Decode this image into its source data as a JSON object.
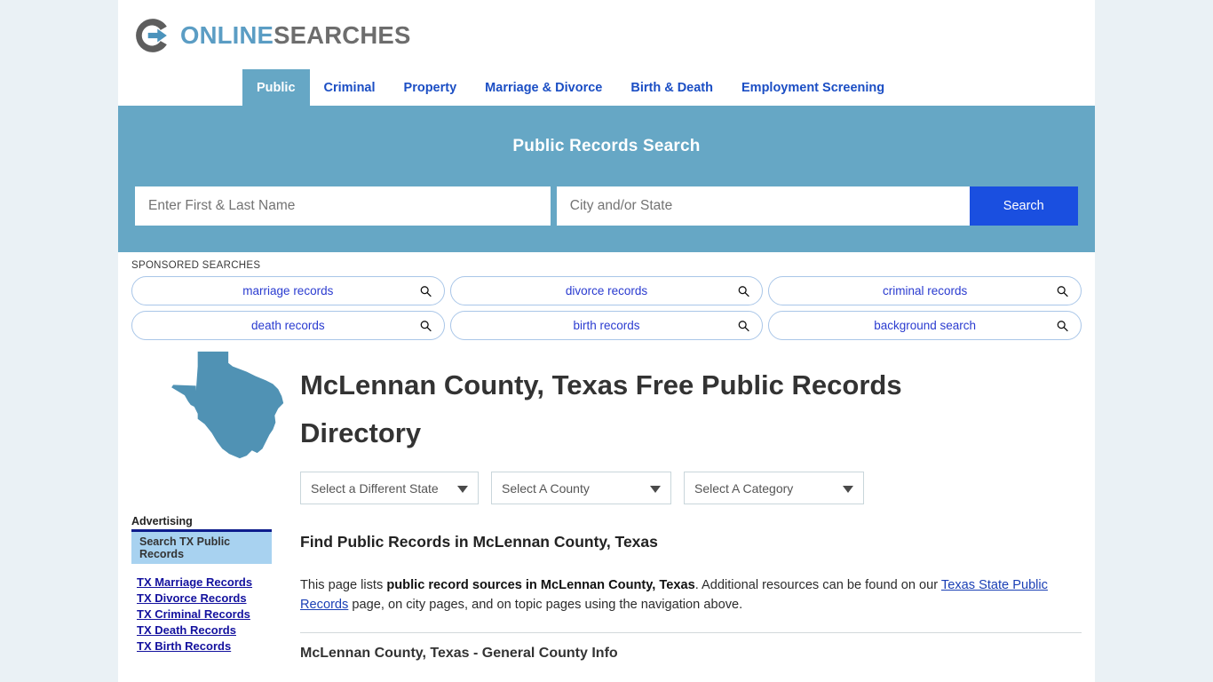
{
  "brand": {
    "name_part1": "ONLINE",
    "name_part2": "SEARCHES",
    "logo_icon": "circle-arrow-logo",
    "color_blue": "#5b9dc4",
    "color_gray": "#6d6d6d"
  },
  "nav": {
    "items": [
      {
        "label": "Public",
        "active": true
      },
      {
        "label": "Criminal",
        "active": false
      },
      {
        "label": "Property",
        "active": false
      },
      {
        "label": "Marriage & Divorce",
        "active": false
      },
      {
        "label": "Birth & Death",
        "active": false
      },
      {
        "label": "Employment Screening",
        "active": false
      }
    ]
  },
  "search": {
    "title": "Public Records Search",
    "name_placeholder": "Enter First & Last Name",
    "name_value": "",
    "city_placeholder": "City and/or State",
    "city_value": "",
    "button_label": "Search",
    "banner_color": "#66a7c5",
    "button_color": "#1a4fe0"
  },
  "sponsored": {
    "label": "SPONSORED SEARCHES",
    "items": [
      {
        "label": "marriage records"
      },
      {
        "label": "divorce records"
      },
      {
        "label": "criminal records"
      },
      {
        "label": "death records"
      },
      {
        "label": "birth records"
      },
      {
        "label": "background search"
      }
    ]
  },
  "main": {
    "state_icon": "texas-state-outline",
    "page_title": "McLennan County, Texas Free Public Records Directory",
    "selectors": [
      {
        "label": "Select a Different State"
      },
      {
        "label": "Select A County"
      },
      {
        "label": "Select A Category"
      }
    ],
    "find_heading": "Find Public Records in McLennan County, Texas",
    "paragraph": {
      "part1": "This page lists ",
      "bold1": "public record sources in McLennan County, Texas",
      "part2": ". Additional resources can be found on our ",
      "link1": "Texas State Public Records",
      "part3": " page, on city pages, and on topic pages using the navigation above."
    },
    "general_info_heading": "McLennan County, Texas - General County Info"
  },
  "sidebar": {
    "advertising_label": "Advertising",
    "ad_box_label": "Search TX Public Records",
    "links": [
      {
        "label": "TX Marriage Records"
      },
      {
        "label": "TX Divorce Records"
      },
      {
        "label": "TX Criminal Records"
      },
      {
        "label": "TX Death Records"
      },
      {
        "label": "TX Birth Records"
      }
    ]
  }
}
